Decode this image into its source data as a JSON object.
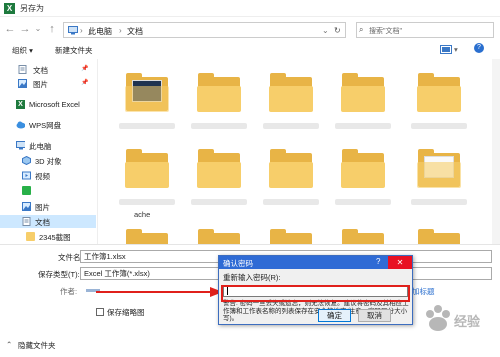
{
  "window": {
    "title": "另存为",
    "app_icon_glyph": "X"
  },
  "address": {
    "crumbs": [
      "此电脑",
      "文档"
    ],
    "separator": "›",
    "search_placeholder": "搜索\"文档\""
  },
  "toolbar": {
    "organize": "组织 ▾",
    "new_folder": "新建文件夹"
  },
  "sidebar": {
    "items": [
      {
        "label": "文档",
        "icon": "document-icon",
        "pin": "📌"
      },
      {
        "label": "图片",
        "icon": "picture-icon",
        "pin": "📌"
      },
      {
        "label": "Microsoft Excel",
        "icon": "excel-icon"
      },
      {
        "label": "WPS网盘",
        "icon": "cloud-icon"
      },
      {
        "label": "此电脑",
        "icon": "computer-icon"
      },
      {
        "label": "3D 对象",
        "icon": "cube-icon"
      },
      {
        "label": "视频",
        "icon": "video-icon"
      },
      {
        "label": "",
        "icon": "app-icon"
      },
      {
        "label": "图片",
        "icon": "picture-icon"
      },
      {
        "label": "文档",
        "icon": "document-icon"
      },
      {
        "label": "2345截图",
        "icon": "folder-icon"
      }
    ]
  },
  "files": {
    "visible_name": "ache"
  },
  "form": {
    "filename_label": "文件名(N):",
    "filename_value": "工作簿1.xlsx",
    "filetype_label": "保存类型(T):",
    "filetype_value": "Excel 工作簿(*.xlsx)",
    "author_label": "作者:",
    "thumbnail_label": "保存缩略图",
    "tag_label": "加标题",
    "hide_folders": "隐藏文件夹"
  },
  "dialog": {
    "title": "确认密码",
    "help": "?",
    "close": "✕",
    "prompt": "重新输入密码(R):",
    "warning": "警告: 密码一旦丢失或遗忘，则无法恢复。建议将密码及其相应工作簿和工作表名称的列表保存在安全的地方(注意，密码区分大小写)。",
    "ok": "确定",
    "cancel": "取消"
  },
  "annotation": {
    "watermark": "百度经验"
  },
  "colors": {
    "excel_green": "#1e7a3e",
    "dialog_blue": "#2f6bd5",
    "highlight_red": "#e0201b",
    "folder_yellow": "#f7ce6a"
  }
}
